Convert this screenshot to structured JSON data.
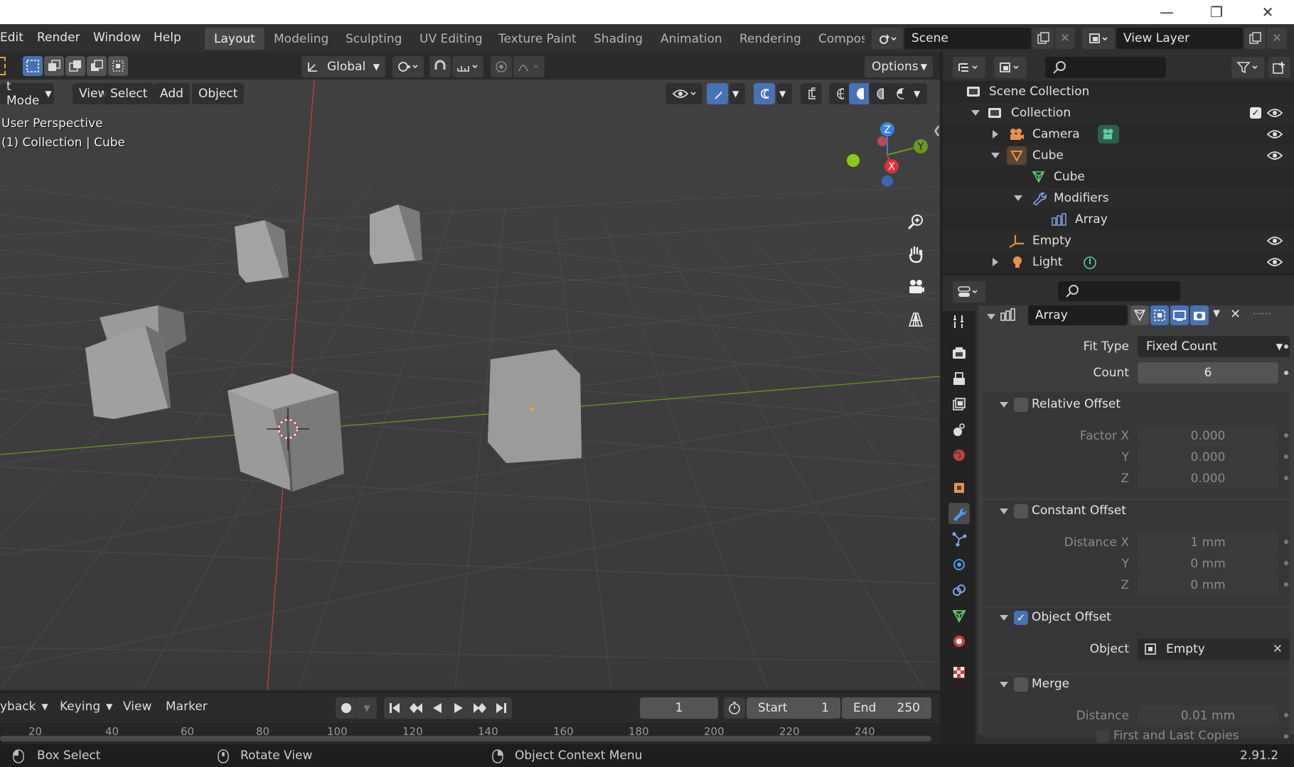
{
  "titlebar": {
    "minimize_icon": "minimize-icon",
    "maximize_icon": "restore-icon",
    "close_icon": "close-icon"
  },
  "menubar": {
    "items": [
      "Edit",
      "Render",
      "Window",
      "Help"
    ]
  },
  "workspaces": {
    "tabs": [
      "Layout",
      "Modeling",
      "Sculpting",
      "UV Editing",
      "Texture Paint",
      "Shading",
      "Animation",
      "Rendering",
      "Compos"
    ],
    "active": "Layout"
  },
  "scene": {
    "name": "Scene"
  },
  "view_layer": {
    "name": "View Layer"
  },
  "tool_header": {
    "transform_orientation": "Global",
    "options_label": "Options"
  },
  "viewport_header": {
    "mode": "t Mode",
    "menus": [
      "View",
      "Select",
      "Add",
      "Object"
    ]
  },
  "viewport": {
    "perspective_label": "User Perspective",
    "context_label": "(1) Collection | Cube",
    "axis_x": "X",
    "axis_y": "Y",
    "axis_z": "Z"
  },
  "outliner": {
    "rows": [
      {
        "label": "Scene Collection"
      },
      {
        "label": "Collection"
      },
      {
        "label": "Camera"
      },
      {
        "label": "Cube"
      },
      {
        "label": "Cube"
      },
      {
        "label": "Modifiers"
      },
      {
        "label": "Array"
      },
      {
        "label": "Empty"
      },
      {
        "label": "Light"
      }
    ]
  },
  "properties": {
    "modifier_name": "Array",
    "fit_type_label": "Fit Type",
    "fit_type_value": "Fixed Count",
    "count_label": "Count",
    "count_value": "6",
    "relative_offset": {
      "title": "Relative Offset",
      "enabled": false,
      "factor_x_label": "Factor X",
      "y_label": "Y",
      "z_label": "Z",
      "x": "0.000",
      "y": "0.000",
      "z": "0.000"
    },
    "constant_offset": {
      "title": "Constant Offset",
      "enabled": false,
      "distance_x_label": "Distance X",
      "y_label": "Y",
      "z_label": "Z",
      "x": "1 mm",
      "y": "0 mm",
      "z": "0 mm"
    },
    "object_offset": {
      "title": "Object Offset",
      "enabled": true,
      "object_label": "Object",
      "object_value": "Empty"
    },
    "merge": {
      "title": "Merge",
      "enabled": false,
      "distance_label": "Distance",
      "distance_value": "0.01 mm",
      "first_last_label": "First and Last Copies"
    }
  },
  "timeline": {
    "menus": [
      "yback",
      "Keying",
      "View",
      "Marker"
    ],
    "current_frame": "1",
    "start_label": "Start",
    "start_value": "1",
    "end_label": "End",
    "end_value": "250",
    "ticks": [
      "20",
      "40",
      "60",
      "80",
      "100",
      "120",
      "140",
      "160",
      "180",
      "200",
      "220",
      "240"
    ]
  },
  "statusbar": {
    "left": "Box Select",
    "middle": "Rotate View",
    "right": "Object Context Menu",
    "version": "2.91.2"
  },
  "colors": {
    "accent_blue": "#4772b3",
    "axis_red": "#d93a3a",
    "axis_green": "#6a9a1f",
    "axis_blue": "#3b7fe0"
  }
}
